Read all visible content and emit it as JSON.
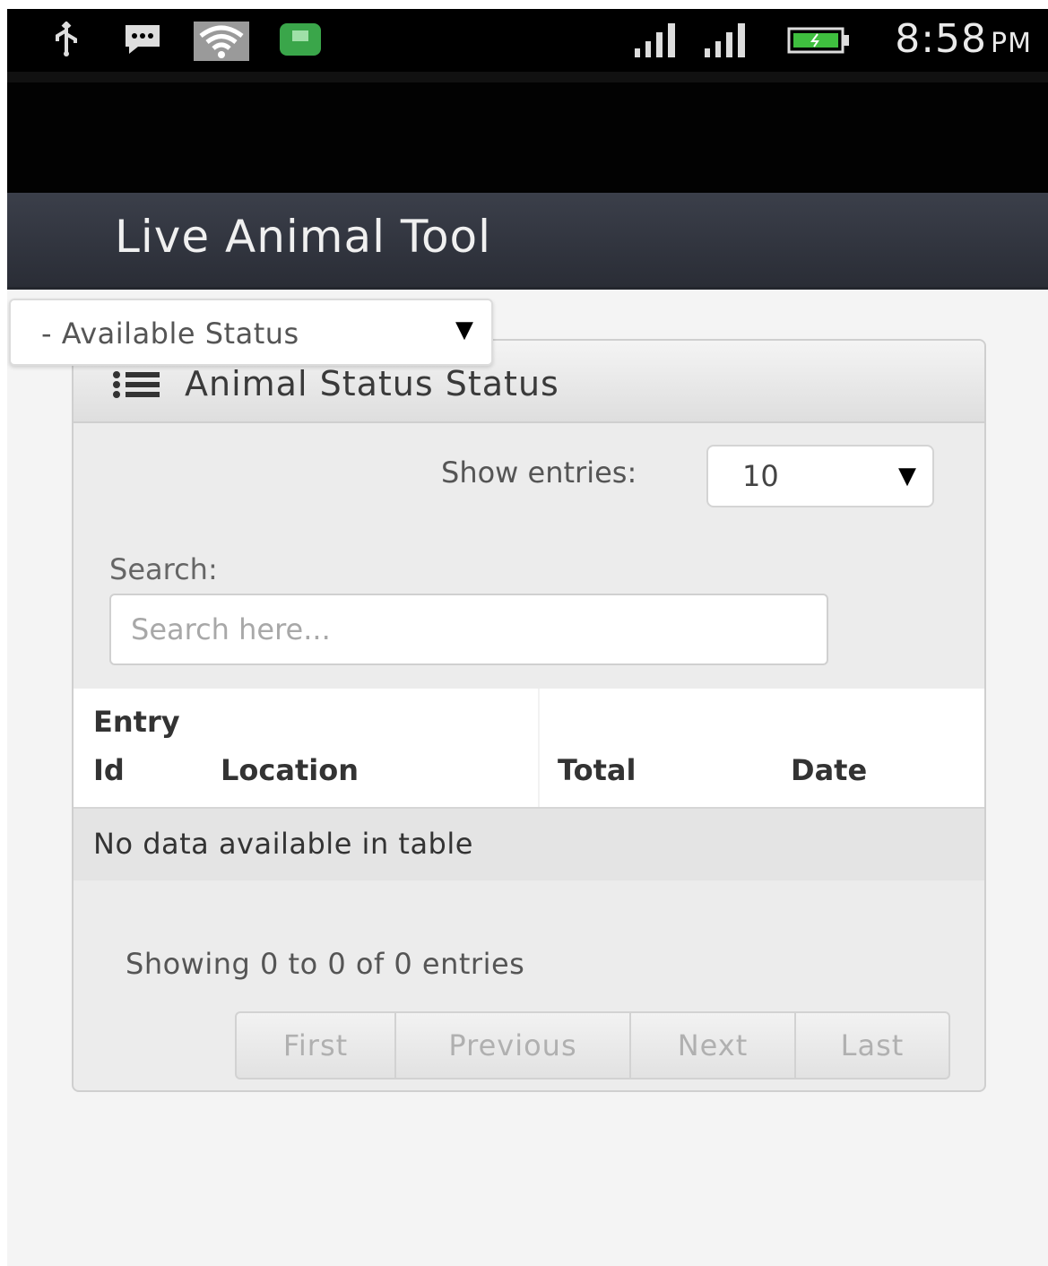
{
  "status_bar": {
    "time": "8:58",
    "ampm": "PM",
    "icons": [
      "usb-icon",
      "chat-icon",
      "wifi-icon",
      "app-notification-icon",
      "signal-icon",
      "signal-icon",
      "battery-icon"
    ]
  },
  "app": {
    "title": "Live Animal Tool"
  },
  "filter": {
    "status_select_value": "- Available Status"
  },
  "panel": {
    "title": "Animal Status Status",
    "show_entries_label": "Show entries:",
    "show_entries_value": "10",
    "search_label": "Search:",
    "search_placeholder": "Search here..."
  },
  "table": {
    "columns": [
      {
        "line1": "Entry",
        "line2": "Id"
      },
      {
        "line1": "",
        "line2": "Location"
      },
      {
        "line1": "",
        "line2": "Total"
      },
      {
        "line1": "",
        "line2": "Date"
      }
    ],
    "empty_message": "No data available in table",
    "info": "Showing 0 to 0 of 0 entries"
  },
  "pagination": {
    "buttons": [
      "First",
      "Previous",
      "Next",
      "Last"
    ]
  },
  "colors": {
    "status_bar": "#000000",
    "app_bar": "#2f333c",
    "panel_bg": "#ececec"
  }
}
